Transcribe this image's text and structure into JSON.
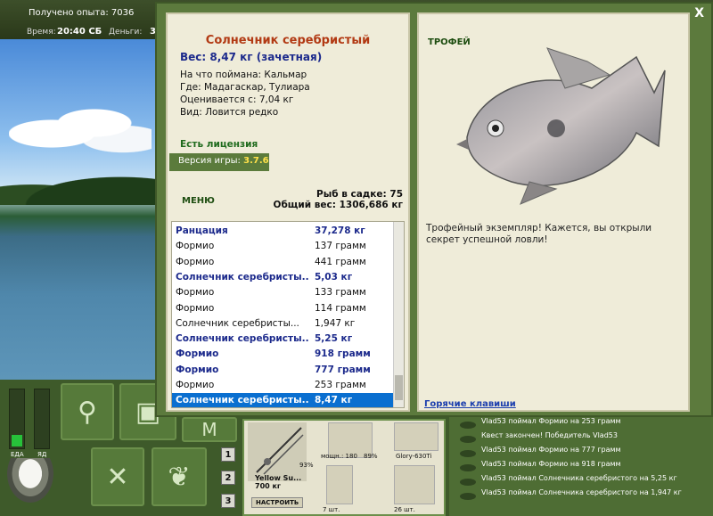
{
  "hud": {
    "experience": "Получено опыта: 7036",
    "time_label": "Время:",
    "time_value": "20:40 СБ",
    "money_label": "Деньги:",
    "money_value": "3"
  },
  "gauges": {
    "food_label": "ЕДА",
    "poison_label": "ЯД",
    "food_level": 0.2,
    "poison_level": 0.0
  },
  "page_buttons": [
    "1",
    "2",
    "3"
  ],
  "tackle": {
    "rod_name": "Yellow Su...",
    "rod_weight": "700 кг",
    "rod_condition": "93%",
    "setup_label": "НАСТРОИТЬ",
    "reel_label": "мощн.: 180",
    "reel_condition": "89%",
    "line_label": "Glory-630Ti",
    "hooks_count": "7 шт.",
    "bait_count": "26 шт."
  },
  "chat": [
    "Vlad53 поймал Формио на 253 грамм",
    "Квест закончен! Победитель Vlad53",
    "Vlad53 поймал Формио на 777 грамм",
    "Vlad53 поймал Формио на 918 грамм",
    "Vlad53 поймал Солнечника серебристого на 5,25 кг",
    "Vlad53 поймал Солнечника серебристого на 1,947 кг"
  ],
  "dialog": {
    "close": "X",
    "fish_name": "Солнечник серебристый",
    "fish_weight": "Вес: 8,47 кг (зачетная)",
    "caught_on": "На что поймана: Кальмар",
    "location": "Где: Мадагаскар, Тулиара",
    "valued_at": "Оценивается с: 7,04 кг",
    "type": "Вид: Ловится редко",
    "license": "Есть лицензия",
    "version_label": "Версия игры:",
    "version_value": "3.7.6",
    "menu": "МЕНЮ",
    "fish_in_keepnet": "Рыб в садке: 75",
    "total_weight": "Общий вес: 1306,686 кг",
    "trophy_title": "ТРОФЕЙ",
    "trophy_text": "Трофейный экземпляр! Кажется, вы открыли секрет успешной ловли!",
    "hotkeys": "Горячие клавиши"
  },
  "catch_list": [
    {
      "name": "Ранцация",
      "weight": "37,278 кг",
      "style": "hl"
    },
    {
      "name": "Формио",
      "weight": "137 грамм",
      "style": ""
    },
    {
      "name": "Формио",
      "weight": "441 грамм",
      "style": ""
    },
    {
      "name": "Солнечник серебристы...",
      "weight": "5,03 кг",
      "style": "hl"
    },
    {
      "name": "Формио",
      "weight": "133 грамм",
      "style": ""
    },
    {
      "name": "Формио",
      "weight": "114 грамм",
      "style": ""
    },
    {
      "name": "Солнечник серебристы...",
      "weight": "1,947 кг",
      "style": ""
    },
    {
      "name": "Солнечник серебристы...",
      "weight": "5,25 кг",
      "style": "hl"
    },
    {
      "name": "Формио",
      "weight": "918 грамм",
      "style": "hl"
    },
    {
      "name": "Формио",
      "weight": "777 грамм",
      "style": "hl"
    },
    {
      "name": "Формио",
      "weight": "253 грамм",
      "style": ""
    },
    {
      "name": "Солнечник серебристы...",
      "weight": "8,47 кг",
      "style": "sel"
    }
  ],
  "colors": {
    "accent": "#5c7a3d",
    "selection": "#0a6fd0",
    "title": "#b23a14",
    "highlight": "#1c2a8c"
  }
}
